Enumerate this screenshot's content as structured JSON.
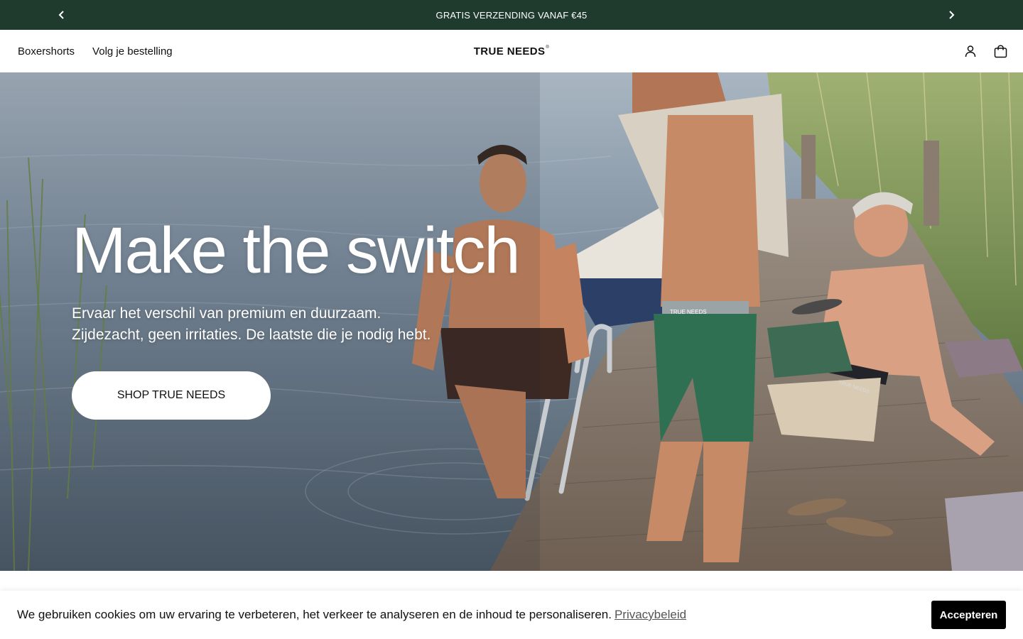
{
  "announcement": {
    "text": "GRATIS VERZENDING VANAF €45",
    "prev_icon": "chevron-left-icon",
    "next_icon": "chevron-right-icon"
  },
  "header": {
    "nav": [
      {
        "label": "Boxershorts"
      },
      {
        "label": "Volg je bestelling"
      }
    ],
    "logo": {
      "text": "TRUE NEEDS",
      "mark": "®"
    },
    "icons": [
      "account-icon",
      "cart-icon"
    ]
  },
  "hero": {
    "title": "Make the switch",
    "subtitle_line1": "Ervaar het verschil van premium en duurzaam.",
    "subtitle_line2": "Zijdezacht, geen irritaties. De laatste die je nodig hebt.",
    "cta_label": "SHOP TRUE NEEDS",
    "image": "three-men-on-lake-jetty-photo",
    "waistband_text_1": "TRUE NEEDS",
    "waistband_text_2": "TRUE NEEDS"
  },
  "cookie_banner": {
    "message": "We gebruiken cookies om uw ervaring te verbeteren, het verkeer te analyseren en de inhoud te personaliseren.",
    "link_label": "Privacybeleid",
    "accept_label": "Accepteren"
  },
  "colors": {
    "announcement_bg": "#1f3b2d",
    "button_bg": "#000000",
    "cta_bg": "#ffffff"
  }
}
